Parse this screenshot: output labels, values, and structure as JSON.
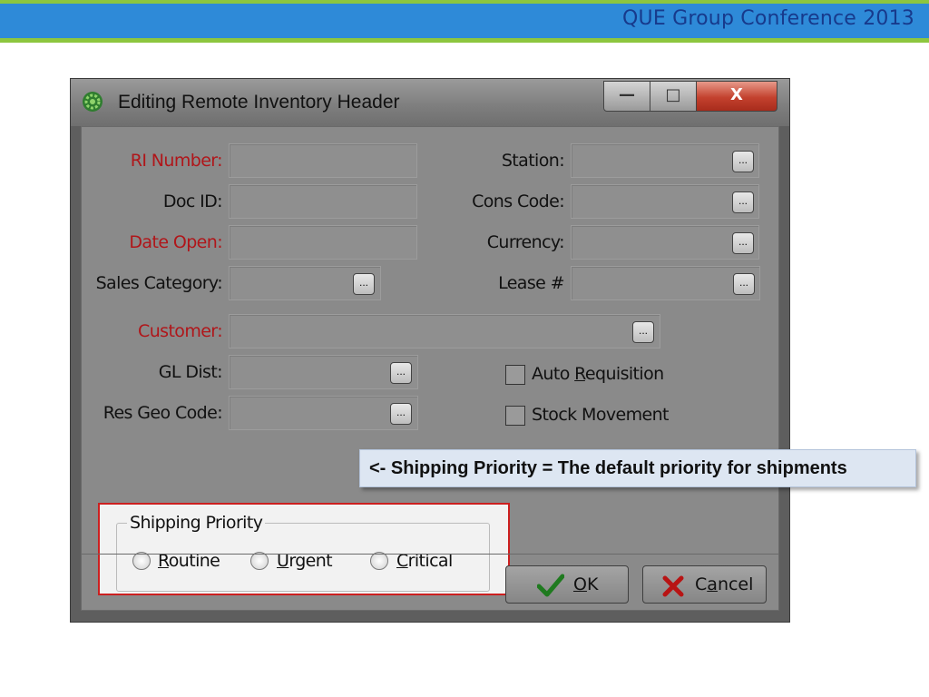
{
  "slide": {
    "header_title": "QUE Group Conference 2013"
  },
  "dialog": {
    "title": "Editing Remote Inventory Header",
    "window_buttons": {
      "minimize": "—",
      "maximize": "□",
      "close": "X"
    },
    "icon": "gear-icon"
  },
  "form": {
    "ri_number": {
      "label": "RI Number:",
      "value": ""
    },
    "doc_id": {
      "label": "Doc ID:",
      "value": ""
    },
    "date_open": {
      "label": "Date Open:",
      "value": ""
    },
    "sales_category": {
      "label": "Sales Category:",
      "value": ""
    },
    "station": {
      "label": "Station:",
      "value": ""
    },
    "cons_code": {
      "label": "Cons Code:",
      "value": ""
    },
    "currency": {
      "label": "Currency:",
      "value": ""
    },
    "lease": {
      "label": "Lease #",
      "value": ""
    },
    "customer": {
      "label": "Customer:",
      "value": ""
    },
    "gl_dist": {
      "label": "GL Dist:",
      "value": ""
    },
    "res_geo_code": {
      "label": "Res Geo Code:",
      "value": ""
    },
    "auto_requisition": {
      "pre": "Auto ",
      "acc": "R",
      "post": "equisition",
      "checked": false
    },
    "stock_movement": {
      "label": "Stock Movement",
      "checked": false
    },
    "lookup_button": "..."
  },
  "shipping_priority": {
    "legend": "Shipping Priority",
    "options": [
      {
        "acc": "R",
        "rest": "outine",
        "selected": false
      },
      {
        "acc": "U",
        "rest": "rgent",
        "selected": false
      },
      {
        "acc": "C",
        "rest": "ritical",
        "selected": false
      }
    ]
  },
  "buttons": {
    "ok": {
      "acc": "O",
      "rest": "K"
    },
    "cancel": {
      "pre": "C",
      "acc": "a",
      "post": "ncel"
    }
  },
  "callout": {
    "text": "<- Shipping Priority = The default priority for shipments"
  },
  "colors": {
    "required_label": "#b0161a",
    "highlight_border": "#cc1f1f",
    "header_band": "#2e8ad8",
    "header_stripe": "#8dc63f"
  }
}
